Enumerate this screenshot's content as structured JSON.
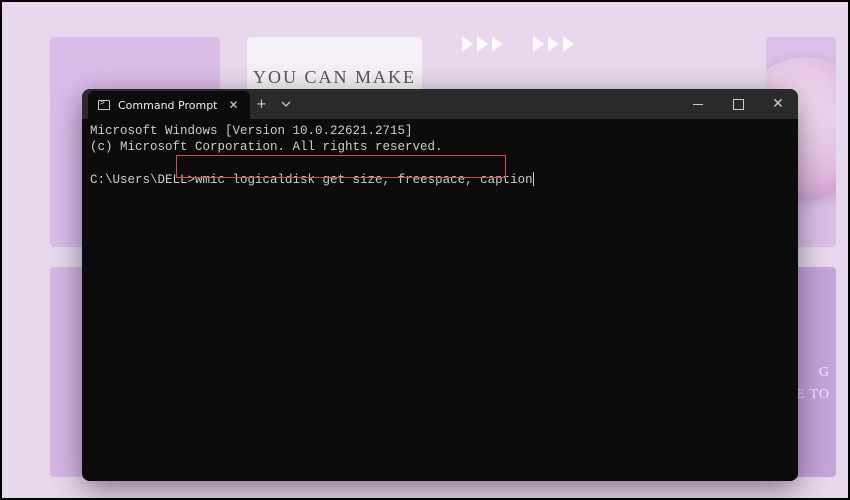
{
  "background": {
    "card2_title": "YOU CAN MAKE",
    "card5_line1": "G",
    "card5_line2": "E TO"
  },
  "window": {
    "tab_title": "Command Prompt"
  },
  "terminal": {
    "line1": "Microsoft Windows [Version 10.0.22621.2715]",
    "line2": "(c) Microsoft Corporation. All rights reserved.",
    "prompt": "C:\\Users\\DELL>",
    "command": "wmic logicaldisk get size, freespace, caption"
  }
}
